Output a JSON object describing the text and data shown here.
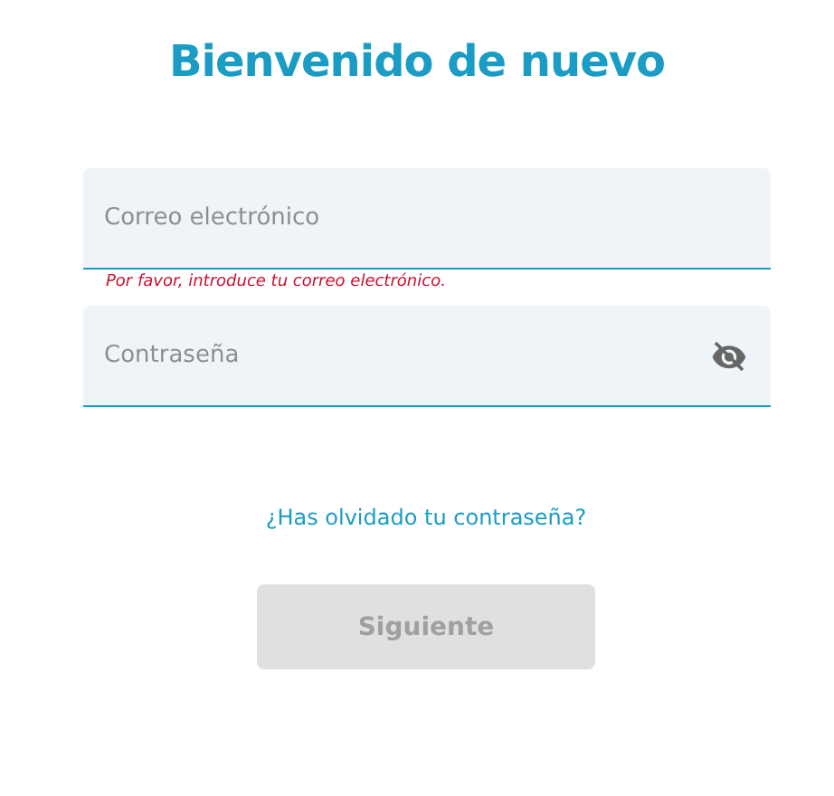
{
  "title": "Bienvenido de nuevo",
  "fields": [
    {
      "kind": "email",
      "placeholder": "Correo electrónico",
      "error": "Por favor, introduce tu correo electrónico."
    },
    {
      "kind": "password",
      "placeholder": "Contraseña",
      "revealed": false
    }
  ],
  "forgot_link": "¿Has olvidado tu contraseña?",
  "submit": {
    "label": "Siguiente",
    "disabled": true
  }
}
